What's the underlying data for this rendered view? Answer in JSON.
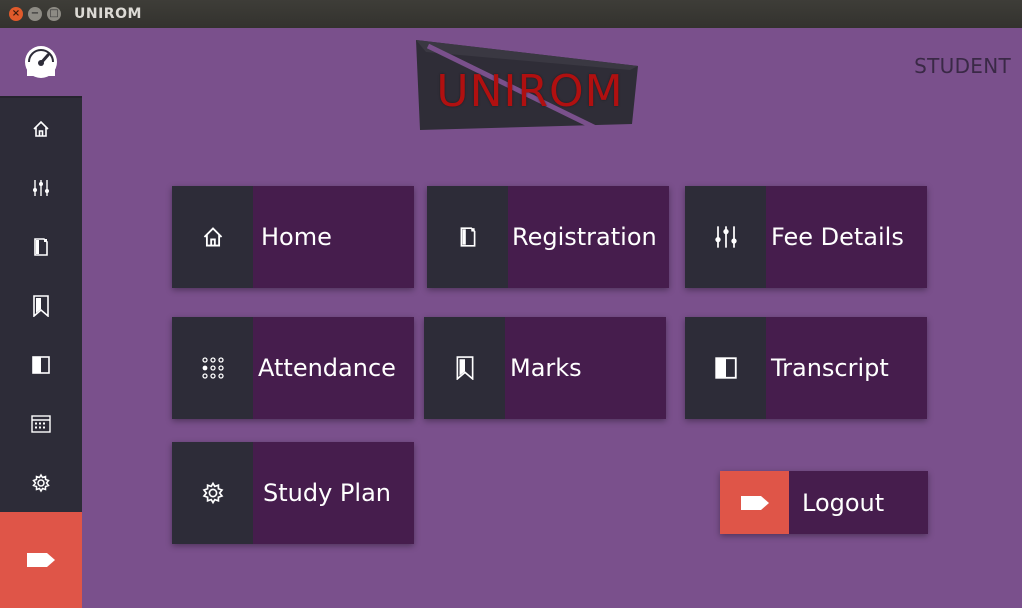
{
  "window": {
    "title": "UNIROM",
    "controls": {
      "close": "×",
      "minimize": "−",
      "maximize": "□"
    }
  },
  "header": {
    "role": "STUDENT",
    "logo_text": "UNIROM"
  },
  "sidebar": {
    "items": [
      {
        "name": "dashboard",
        "icon": "gauge-icon"
      },
      {
        "name": "home",
        "icon": "home-icon"
      },
      {
        "name": "fee-details",
        "icon": "sliders-icon"
      },
      {
        "name": "registration",
        "icon": "document-icon"
      },
      {
        "name": "marks",
        "icon": "bookmark-icon"
      },
      {
        "name": "transcript",
        "icon": "half-square-icon"
      },
      {
        "name": "attendance",
        "icon": "calendar-icon"
      },
      {
        "name": "study-plan",
        "icon": "gear-icon"
      },
      {
        "name": "logout",
        "icon": "tag-icon"
      }
    ]
  },
  "tiles": {
    "home": {
      "label": "Home",
      "icon": "home-icon"
    },
    "registration": {
      "label": "Registration",
      "icon": "document-icon"
    },
    "fee_details": {
      "label": "Fee Details",
      "icon": "sliders-icon"
    },
    "attendance": {
      "label": "Attendance",
      "icon": "dots-grid-icon"
    },
    "marks": {
      "label": "Marks",
      "icon": "bookmark-icon"
    },
    "transcript": {
      "label": "Transcript",
      "icon": "half-square-icon"
    },
    "study_plan": {
      "label": "Study Plan",
      "icon": "gear-icon"
    },
    "logout": {
      "label": "Logout",
      "icon": "tag-icon"
    }
  },
  "colors": {
    "background": "#7a508c",
    "sidebar": "#2d2c38",
    "tile_label": "#461d4d",
    "accent_red": "#df5548",
    "logo_red": "#b01010"
  }
}
